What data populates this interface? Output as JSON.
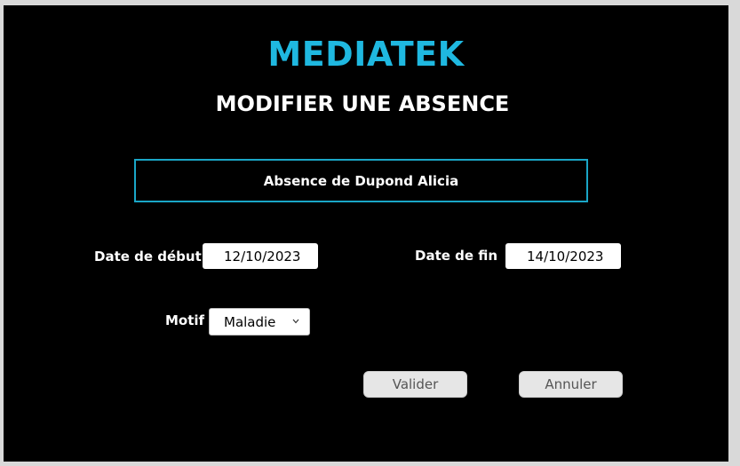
{
  "app": {
    "title": "MEDIATEK",
    "title_color": "#1fb8e0"
  },
  "page": {
    "title": "MODIFIER UNE ABSENCE"
  },
  "subject": {
    "text": "Absence de Dupond Alicia",
    "border_color": "#1aa6c7"
  },
  "form": {
    "start_date": {
      "label": "Date de début",
      "value": "12/10/2023"
    },
    "end_date": {
      "label": "Date de fin",
      "value": "14/10/2023"
    },
    "motif": {
      "label": "Motif",
      "selected": "Maladie",
      "icon": "chevron-down-icon"
    }
  },
  "buttons": {
    "validate_label": "Valider",
    "cancel_label": "Annuler"
  }
}
